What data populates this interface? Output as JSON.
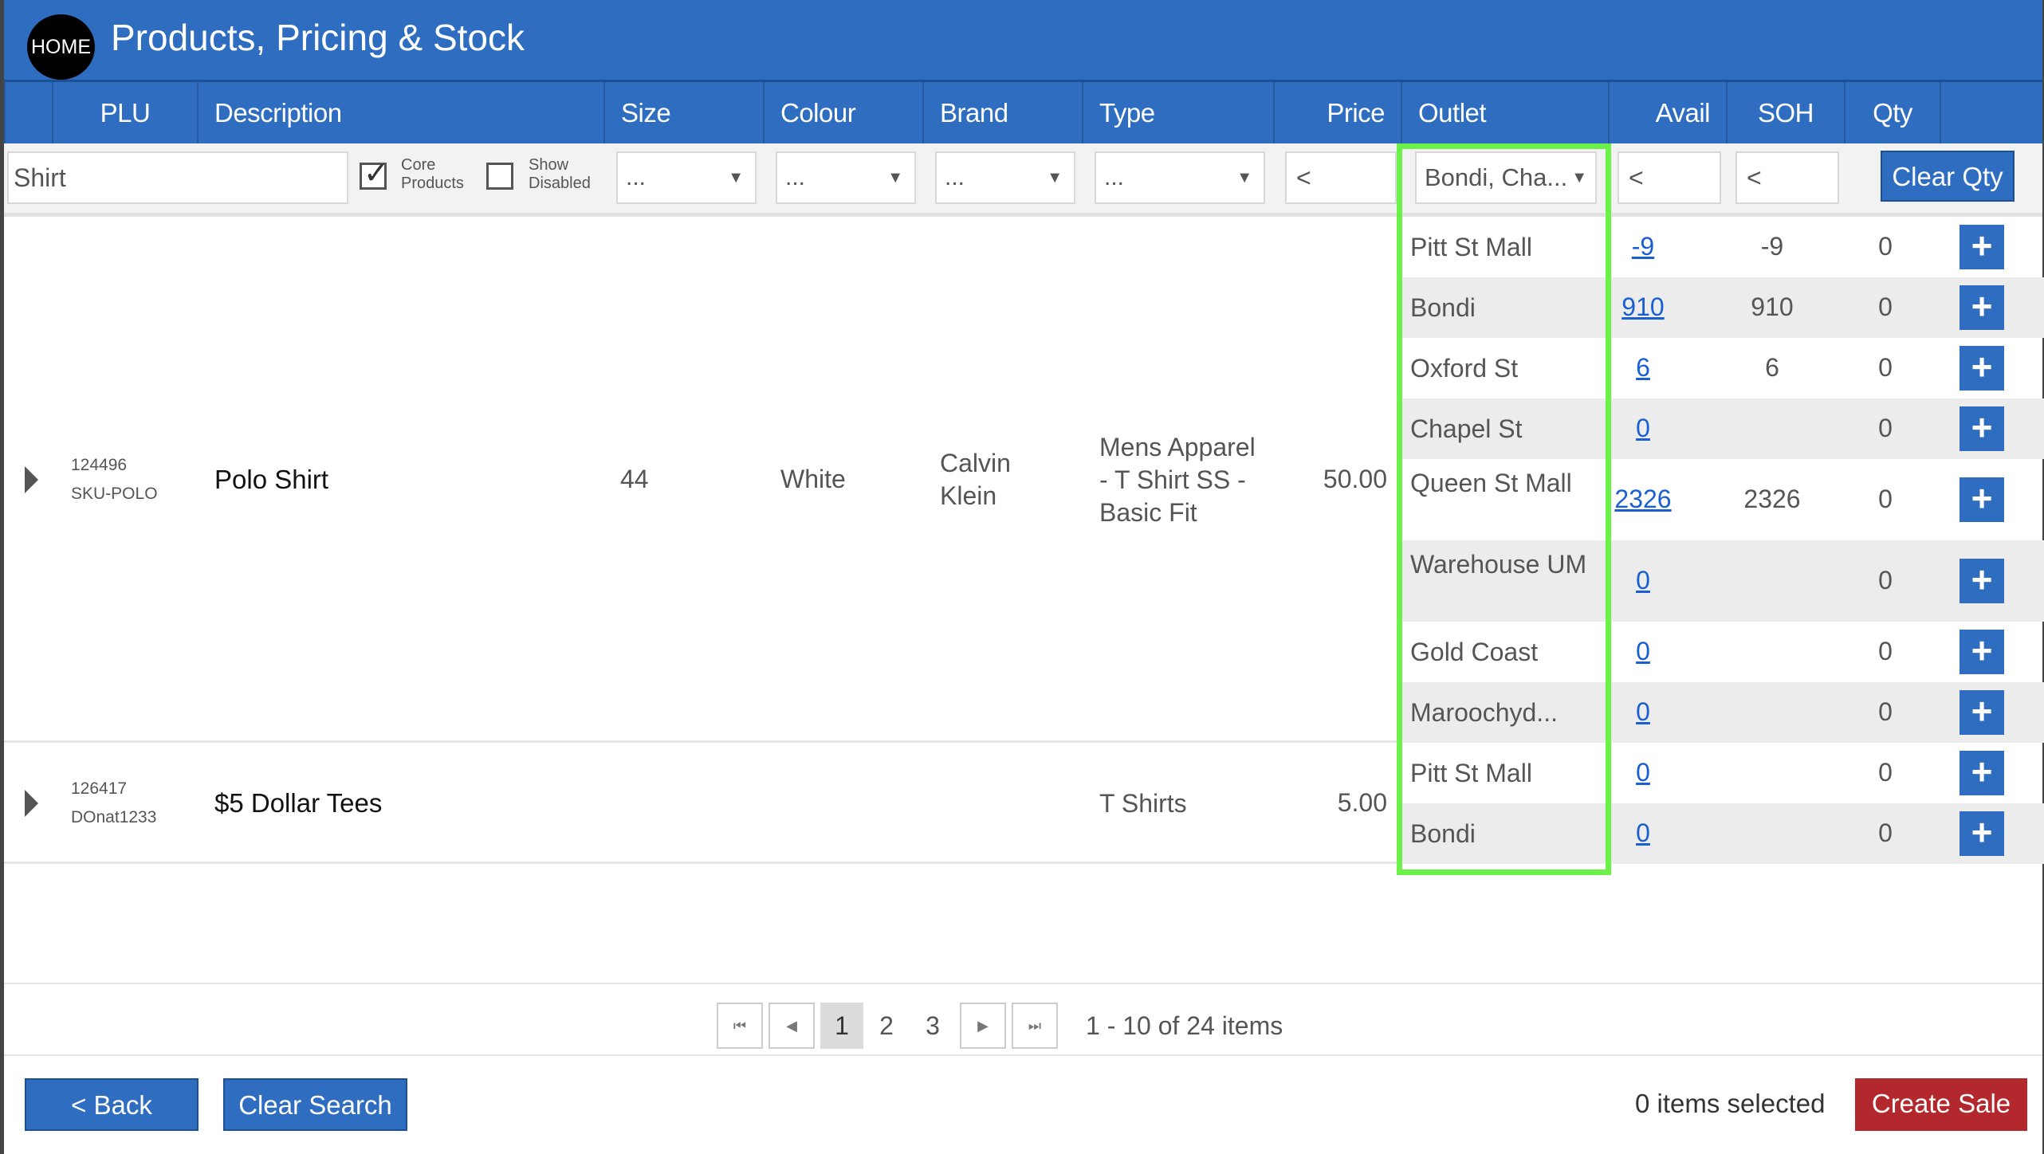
{
  "header": {
    "home_label": "HOME",
    "title": "Products, Pricing & Stock"
  },
  "columns": {
    "plu": "PLU",
    "description": "Description",
    "size": "Size",
    "colour": "Colour",
    "brand": "Brand",
    "type": "Type",
    "price": "Price",
    "outlet": "Outlet",
    "avail": "Avail",
    "soh": "SOH",
    "qty": "Qty"
  },
  "filters": {
    "search_value": "Shirt",
    "core_products_label": "Core Products",
    "core_products_checked": true,
    "show_disabled_label": "Show Disabled",
    "show_disabled_checked": false,
    "size_value": "...",
    "colour_value": "...",
    "brand_value": "...",
    "type_value": "...",
    "price_value": "<",
    "outlet_value": "Bondi, Cha...",
    "avail_value": "<",
    "soh_value": "<",
    "clear_qty_label": "Clear Qty"
  },
  "products": [
    {
      "plu": "124496",
      "sku": "SKU-POLO",
      "description": "Polo Shirt",
      "size": "44",
      "colour": "White",
      "brand": "Calvin Klein",
      "type": "Mens Apparel - T Shirt SS - Basic Fit",
      "price": "50.00",
      "outlets": [
        {
          "name": "Pitt St Mall",
          "avail": "-9",
          "soh": "-9",
          "qty": "0"
        },
        {
          "name": "Bondi",
          "avail": "910",
          "soh": "910",
          "qty": "0"
        },
        {
          "name": "Oxford St",
          "avail": "6",
          "soh": "6",
          "qty": "0"
        },
        {
          "name": "Chapel St",
          "avail": "0",
          "soh": "",
          "qty": "0"
        },
        {
          "name": "Queen St Mall",
          "avail": "2326",
          "soh": "2326",
          "qty": "0"
        },
        {
          "name": "Warehouse UM",
          "avail": "0",
          "soh": "",
          "qty": "0"
        },
        {
          "name": "Gold Coast",
          "avail": "0",
          "soh": "",
          "qty": "0"
        },
        {
          "name": "Maroochyd...",
          "avail": "0",
          "soh": "",
          "qty": "0"
        }
      ]
    },
    {
      "plu": "126417",
      "sku": "DOnat1233",
      "description": "$5 Dollar Tees",
      "size": "",
      "colour": "",
      "brand": "",
      "type": "T Shirts",
      "price": "5.00",
      "outlets": [
        {
          "name": "Pitt St Mall",
          "avail": "0",
          "soh": "",
          "qty": "0"
        },
        {
          "name": "Bondi",
          "avail": "0",
          "soh": "",
          "qty": "0"
        }
      ]
    }
  ],
  "pager": {
    "pages": [
      "1",
      "2",
      "3"
    ],
    "current": "1",
    "info": "1 - 10 of 24 items"
  },
  "footer": {
    "back_label": "< Back",
    "clear_search_label": "Clear Search",
    "selected_info": "0 items selected",
    "create_sale_label": "Create Sale"
  },
  "colors": {
    "primary": "#2f6dc0",
    "danger": "#b3282d",
    "highlight": "#6cf04a",
    "link": "#1a5fd1"
  },
  "icons": {
    "add": "plus-icon",
    "expand": "expand-triangle-icon",
    "checkbox": "checkmark-icon"
  }
}
